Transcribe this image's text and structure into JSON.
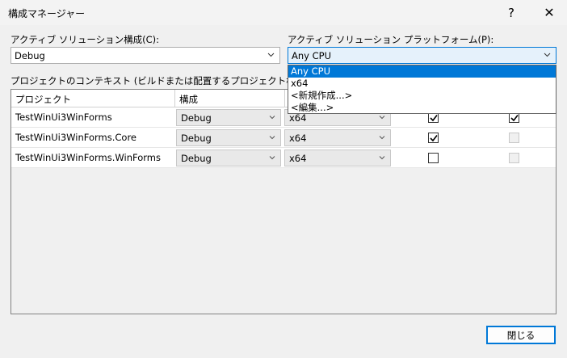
{
  "window": {
    "title": "構成マネージャー",
    "help": "?",
    "close": "✕"
  },
  "solution_config": {
    "label": "アクティブ ソリューション構成(C):",
    "value": "Debug"
  },
  "solution_platform": {
    "label": "アクティブ ソリューション プラットフォーム(P):",
    "value": "Any CPU",
    "options": [
      "Any CPU",
      "x64",
      "<新規作成...>",
      "<編集...>"
    ],
    "selected_index": 0
  },
  "context": {
    "label": "プロジェクトのコンテキスト (ビルドまたは配置するプロジェクト構成をチェック)(",
    "headers": [
      "プロジェクト",
      "構成"
    ],
    "rows": [
      {
        "project": "TestWinUi3WinForms",
        "config": "Debug",
        "platform": "x64",
        "build": true,
        "deploy": true,
        "deploy_enabled": true
      },
      {
        "project": "TestWinUi3WinForms.Core",
        "config": "Debug",
        "platform": "x64",
        "build": true,
        "deploy": false,
        "deploy_enabled": false
      },
      {
        "project": "TestWinUi3WinForms.WinForms",
        "config": "Debug",
        "platform": "x64",
        "build": false,
        "deploy": false,
        "deploy_enabled": false
      }
    ]
  },
  "buttons": {
    "close_label": "閉じる"
  },
  "colors": {
    "accent": "#0078d7",
    "background": "#f0f0f0"
  }
}
